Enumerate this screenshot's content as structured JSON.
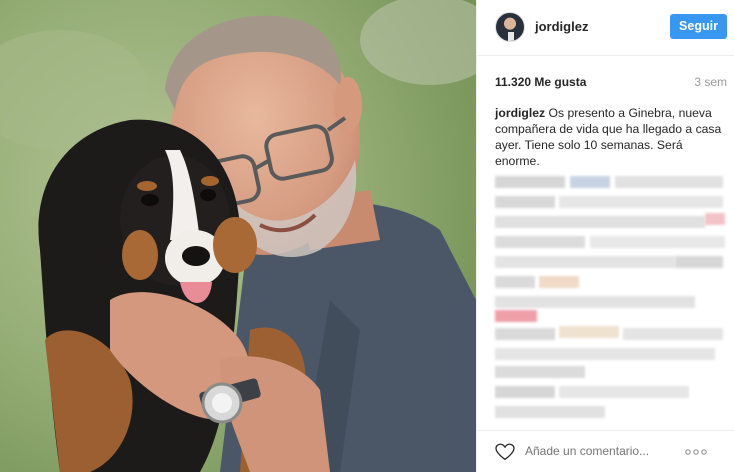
{
  "user": {
    "username": "jordiglez",
    "follow_label": "Seguir"
  },
  "post": {
    "likes": "11.320 Me gusta",
    "time": "3 sem",
    "caption_user": "jordiglez",
    "caption_text": "Os presento a Ginebra, nueva compañera de vida que ha llegado a casa ayer. Tiene solo 10 semanas. Será enorme."
  },
  "comment_box": {
    "placeholder": "Añade un comentario..."
  },
  "icons": [
    "heart-icon",
    "more-options-icon"
  ],
  "colors": {
    "accent": "#3897f0",
    "text": "#262626",
    "muted": "#999999"
  }
}
